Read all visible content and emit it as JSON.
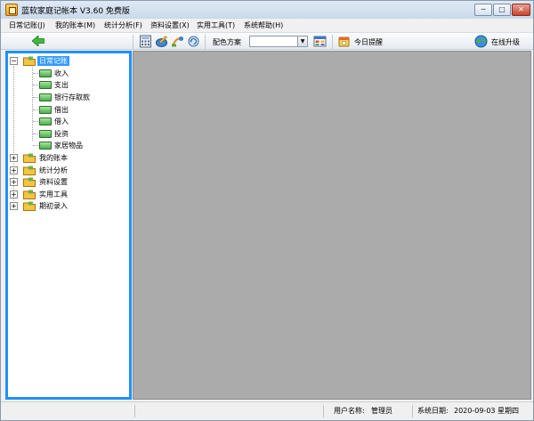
{
  "window": {
    "title": "蓝软家庭记帐本 V3.60  免费版",
    "buttons": {
      "minimize": "─",
      "maximize": "□",
      "close": "✕"
    }
  },
  "menu": [
    {
      "label": "日常记账(J)"
    },
    {
      "label": "我的账本(M)"
    },
    {
      "label": "统计分析(F)"
    },
    {
      "label": "资料设置(X)"
    },
    {
      "label": "实用工具(T)"
    },
    {
      "label": "系统帮助(H)"
    }
  ],
  "toolbar": {
    "scheme_label": "配色方案",
    "scheme_value": "",
    "reminder_label": "今日提醒",
    "upgrade_label": "在线升级",
    "icons": [
      "back-arrow-icon",
      "calculator-icon",
      "edit-icon",
      "transfer-icon",
      "refresh-icon",
      "palette-icon",
      "reminder-icon",
      "globe-icon"
    ]
  },
  "tree": {
    "root": {
      "label": "日常记账",
      "expanded": true,
      "selected": true
    },
    "children": [
      {
        "label": "收入"
      },
      {
        "label": "支出"
      },
      {
        "label": "银行存取款"
      },
      {
        "label": "借出"
      },
      {
        "label": "借入"
      },
      {
        "label": "投资"
      },
      {
        "label": "家居物品"
      }
    ],
    "siblings": [
      {
        "label": "我的账本"
      },
      {
        "label": "统计分析"
      },
      {
        "label": "资料设置"
      },
      {
        "label": "实用工具"
      },
      {
        "label": "期初录入"
      }
    ]
  },
  "status": {
    "user_label": "用户名称:",
    "user_name": "管理员",
    "date_label": "系统日期:",
    "date_value": "2020-09-03",
    "weekday": "星期四"
  },
  "colors": {
    "tree_border": "#1e90ff",
    "content_bg": "#ababab",
    "selection": "#3399ff"
  }
}
